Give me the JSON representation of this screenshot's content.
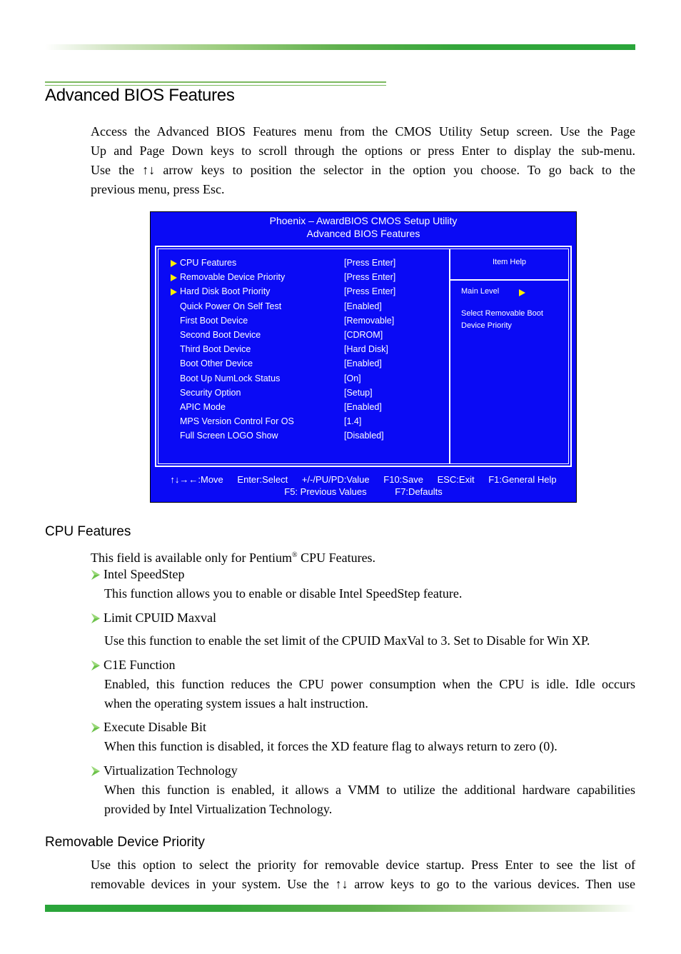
{
  "page": {
    "title": "Advanced BIOS Features",
    "intro_lines": [
      "Access the Advanced BIOS Features menu from the CMOS Utility Setup screen. Use the Page",
      "Up and Page Down keys to scroll through the options or press Enter to display the sub-menu.",
      "Use the ↑↓ arrow keys to position the selector in the option you choose. To go back to the",
      "previous menu, press Esc."
    ],
    "colors": {
      "accent_green": "#2aa53a",
      "bios_blue": "#0a0af5",
      "bios_arrow_yellow": "#ffee00",
      "bullet_green": "#6cc24a"
    }
  },
  "bios": {
    "title_line1": "Phoenix – AwardBIOS CMOS Setup Utility",
    "title_line2": "Advanced BIOS Features",
    "items": [
      {
        "label": "CPU Features",
        "value": "[Press Enter]",
        "submenu": true
      },
      {
        "label": "Removable Device Priority",
        "value": "[Press Enter]",
        "submenu": true
      },
      {
        "label": "Hard Disk Boot Priority",
        "value": "[Press Enter]",
        "submenu": true
      },
      {
        "label": "Quick Power On Self Test",
        "value": "[Enabled]",
        "submenu": false
      },
      {
        "label": "First Boot Device",
        "value": "[Removable]",
        "submenu": false
      },
      {
        "label": "Second Boot Device",
        "value": "[CDROM]",
        "submenu": false
      },
      {
        "label": "Third Boot Device",
        "value": "[Hard Disk]",
        "submenu": false
      },
      {
        "label": "Boot Other Device",
        "value": "[Enabled]",
        "submenu": false
      },
      {
        "label": "Boot Up NumLock Status",
        "value": "[On]",
        "submenu": false
      },
      {
        "label": "Security Option",
        "value": "[Setup]",
        "submenu": false
      },
      {
        "label": "APIC Mode",
        "value": "[Enabled]",
        "submenu": false
      },
      {
        "label": "MPS Version Control For OS",
        "value": "[1.4]",
        "submenu": false
      },
      {
        "label": "Full Screen LOGO Show",
        "value": "[Disabled]",
        "submenu": false
      }
    ],
    "help": {
      "title": "Item Help",
      "main_level": "Main Level",
      "desc_line1": "Select Removable Boot",
      "desc_line2": "Device Priority"
    },
    "footer": {
      "line1": [
        "↑↓→←:Move",
        "Enter:Select",
        "+/-/PU/PD:Value",
        "F10:Save",
        "ESC:Exit",
        "F1:General Help"
      ],
      "line2": [
        "F5: Previous Values",
        "F7:Defaults"
      ]
    }
  },
  "cpu_section": {
    "heading": "CPU Features",
    "intro_pre": "This field is available only for Pentium",
    "intro_sup": "®",
    "intro_post": " CPU Features.",
    "bullets": [
      {
        "title": "Intel SpeedStep",
        "lines": [
          "This function allows you to enable or disable Intel SpeedStep feature."
        ]
      },
      {
        "title": "Limit CPUID Maxval",
        "lines": [
          "Use this function to enable the set limit of the CPUID MaxVal to 3. Set to Disable for Win XP."
        ]
      },
      {
        "title": "C1E Function",
        "lines": [
          "Enabled, this function reduces the CPU power consumption when the CPU is idle. Idle occurs",
          "when the operating system issues a halt instruction."
        ]
      },
      {
        "title": "Execute Disable Bit",
        "lines": [
          "When this function is disabled, it forces the XD feature flag to always return to zero (0)."
        ]
      },
      {
        "title": "Virtualization Technology",
        "lines": [
          "When this function is enabled, it allows a VMM to utilize the additional hardware capabilities",
          "provided by Intel Virtualization Technology."
        ]
      }
    ]
  },
  "removable_section": {
    "heading": "Removable Device Priority",
    "lines": [
      "Use this option to select the priority for removable device startup. Press Enter to see the list of",
      "removable devices in your system. Use the ↑↓ arrow keys to go to the various devices. Then use"
    ]
  }
}
